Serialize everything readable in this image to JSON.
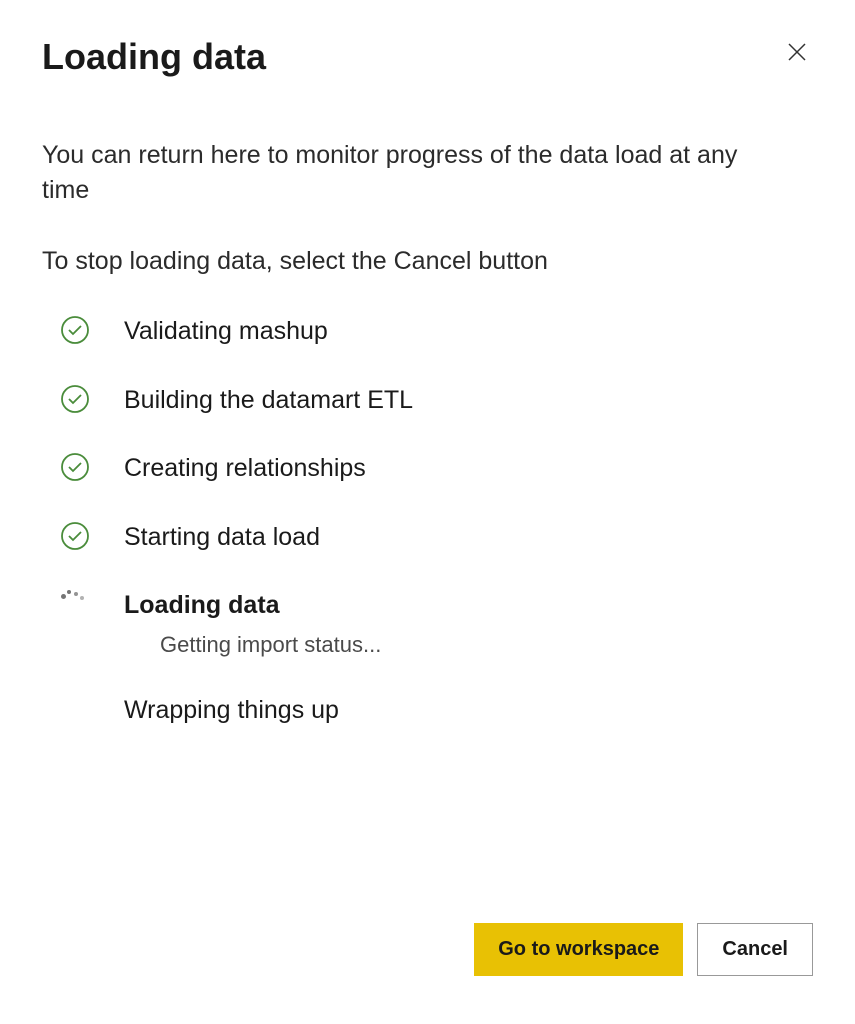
{
  "dialog": {
    "title": "Loading data",
    "description1": "You can return here to monitor progress of the data load at any time",
    "description2": "To stop loading data, select the Cancel button",
    "steps": [
      {
        "label": "Validating mashup",
        "status": "done"
      },
      {
        "label": "Building the datamart ETL",
        "status": "done"
      },
      {
        "label": "Creating relationships",
        "status": "done"
      },
      {
        "label": "Starting data load",
        "status": "done"
      },
      {
        "label": "Loading data",
        "status": "active",
        "sublabel": "Getting import status..."
      },
      {
        "label": "Wrapping things up",
        "status": "pending"
      }
    ],
    "buttons": {
      "primary": "Go to workspace",
      "secondary": "Cancel"
    }
  }
}
